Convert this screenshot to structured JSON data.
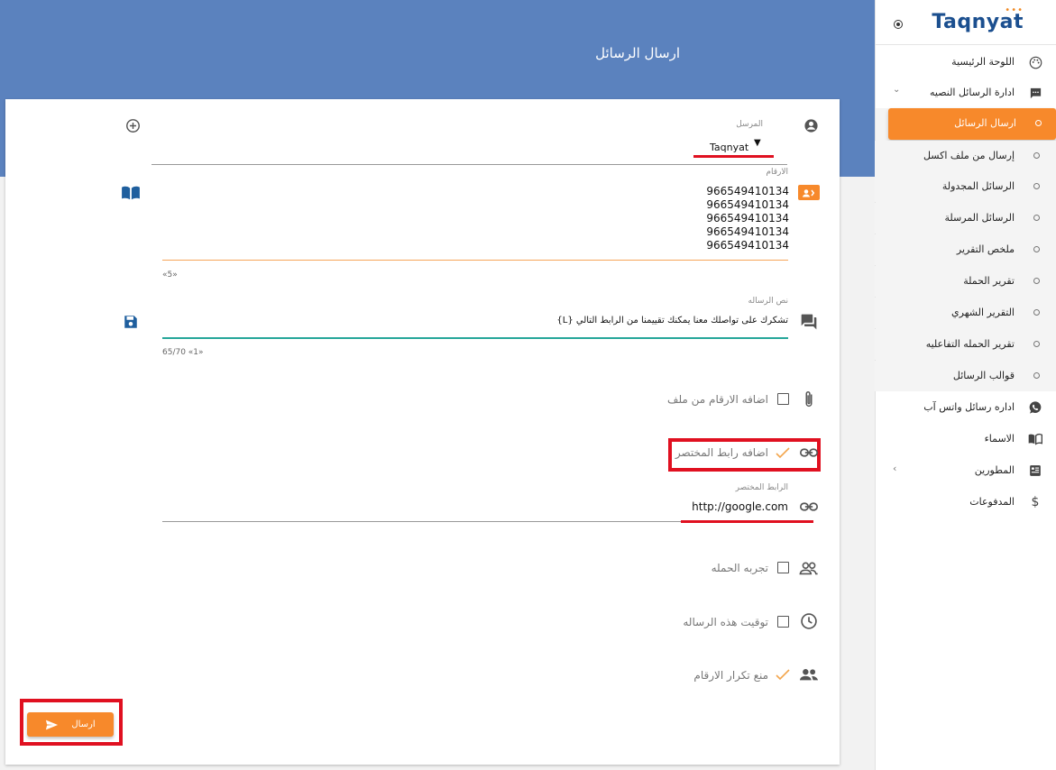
{
  "page": {
    "title": "ارسال الرسائل"
  },
  "form": {
    "sender_label": "المرسل",
    "sender_value": "Taqnyat",
    "numbers_label": "الارقام",
    "numbers": [
      "966549410134",
      "966549410134",
      "966549410134",
      "966549410134",
      "966549410134"
    ],
    "numbers_count": "«5»",
    "message_label": "نص الرساله",
    "message_value": "تشكرك على تواصلك معنا يمكنك تقييمنا من الرابط التالي {L}",
    "message_counter": "65/70 «1»",
    "option_file": "اضافه الارقام من ملف",
    "option_shortlink": "اضافه رابط المختصر",
    "shortlink_label": "الرابط المختصر",
    "shortlink_value": "http://google.com",
    "option_trial": "تجربه الحمله",
    "option_schedule": "توقيت هذه الرساله",
    "option_dedupe": "منع تكرار الارقام",
    "send_label": "ارسال"
  },
  "sidebar": {
    "logo": "Taqnyat",
    "items": [
      {
        "label": "اللوحة الرئيسية",
        "icon": "palette-icon"
      },
      {
        "label": "ادارة الرسائل النصيه",
        "icon": "sms-icon"
      },
      {
        "label": "ارسال الرسائل",
        "icon": "dot"
      },
      {
        "label": "إرسال من ملف اكسل",
        "icon": "dot"
      },
      {
        "label": "الرسائل المجدولة",
        "icon": "dot"
      },
      {
        "label": "الرسائل المرسلة",
        "icon": "dot"
      },
      {
        "label": "ملخص التقرير",
        "icon": "dot"
      },
      {
        "label": "تقرير الحملة",
        "icon": "dot"
      },
      {
        "label": "التقرير الشهري",
        "icon": "dot"
      },
      {
        "label": "تقرير الحمله التفاعليه",
        "icon": "dot"
      },
      {
        "label": "قوالب الرسائل",
        "icon": "dot"
      },
      {
        "label": "اداره رسائل واتس آب",
        "icon": "whatsapp-icon"
      },
      {
        "label": "الاسماء",
        "icon": "book-icon"
      },
      {
        "label": "المطورين",
        "icon": "dev-icon"
      },
      {
        "label": "المدفوعات",
        "icon": "dollar-icon"
      }
    ]
  },
  "colors": {
    "header": "#5b82be",
    "accent": "#f7892b",
    "highlight": "#e01020",
    "message_underline": "#26a69a"
  }
}
